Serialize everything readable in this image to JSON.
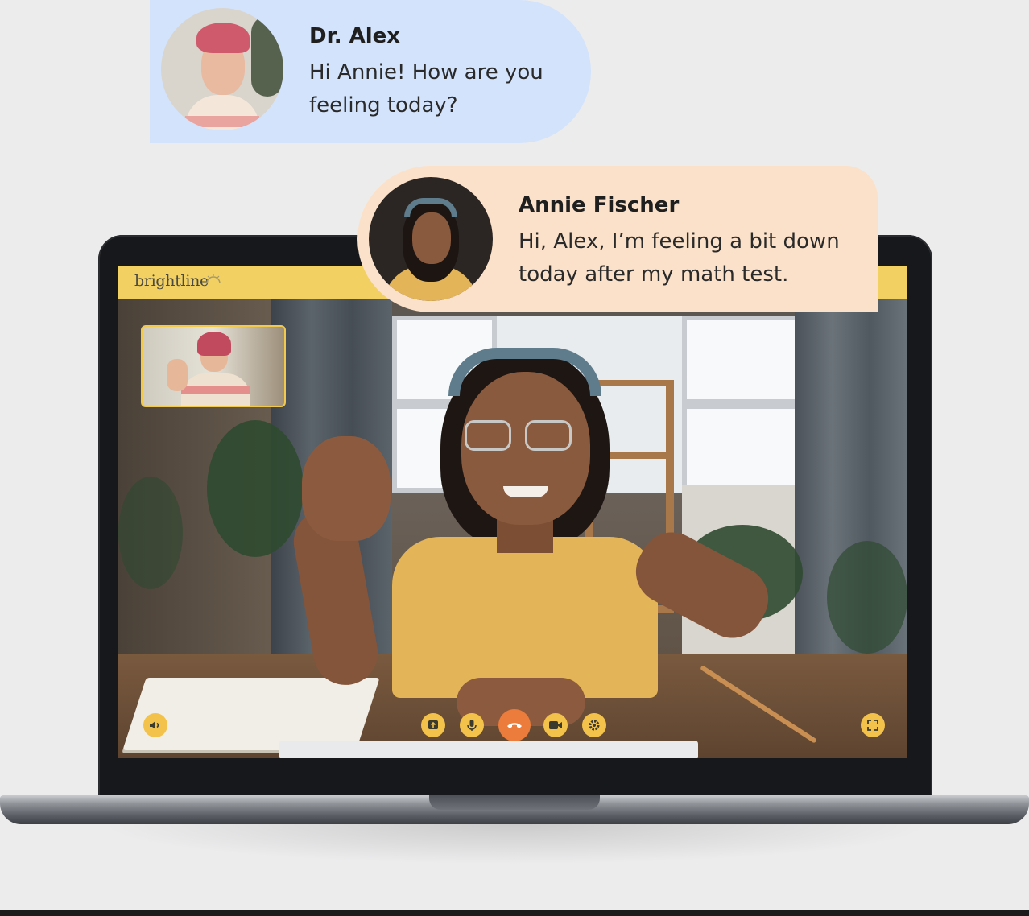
{
  "messages": [
    {
      "sender": "Dr. Alex",
      "text_lines": [
        "Hi Annie! How are you",
        "feeling today?"
      ]
    },
    {
      "sender": "Annie Fischer",
      "text_lines": [
        "Hi, Alex, I’m feeling a bit down",
        "today after my math test."
      ]
    }
  ],
  "app": {
    "brand": "brightline",
    "colors": {
      "header": "#f2d162",
      "control": "#f2c24b",
      "end_call": "#ec7c3b",
      "alex_bubble": "#d3e3fb",
      "annie_bubble": "#fbe1c9"
    }
  },
  "controls": {
    "left": [
      "volume-icon"
    ],
    "center": [
      "share-screen-icon",
      "microphone-icon",
      "end-call-icon",
      "camera-icon",
      "settings-icon"
    ],
    "right": [
      "fullscreen-icon"
    ]
  }
}
